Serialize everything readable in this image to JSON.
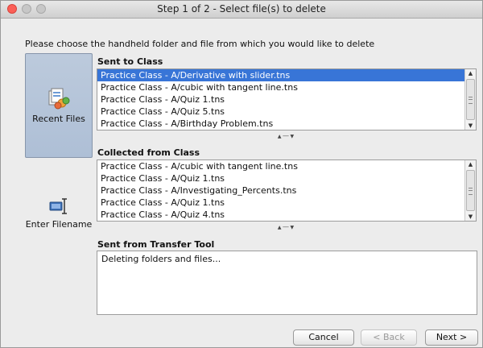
{
  "window": {
    "title": "Step 1 of 2 - Select file(s) to delete"
  },
  "instruction": "Please choose the handheld folder and file from which you would like to delete",
  "sidebar": {
    "items": [
      {
        "label": "Recent Files",
        "icon": "recent-files-icon",
        "selected": true
      },
      {
        "label": "Enter Filename",
        "icon": "enter-filename-icon",
        "selected": false
      }
    ]
  },
  "sent_to_class": {
    "label": "Sent to Class",
    "items": [
      "Practice Class - A/Derivative with slider.tns",
      "Practice Class - A/cubic with tangent line.tns",
      "Practice Class - A/Quiz 1.tns",
      "Practice Class - A/Quiz 5.tns",
      "Practice Class - A/Birthday Problem.tns"
    ],
    "selected_index": 0
  },
  "collected_from_class": {
    "label": "Collected from Class",
    "items": [
      "Practice Class - A/cubic with tangent line.tns",
      "Practice Class - A/Quiz 1.tns",
      "Practice Class - A/Investigating_Percents.tns",
      "Practice Class - A/Quiz 1.tns",
      "Practice Class - A/Quiz 4.tns"
    ]
  },
  "transfer_tool": {
    "label": "Sent from Transfer Tool",
    "log": "Deleting folders and files..."
  },
  "buttons": {
    "cancel": "Cancel",
    "back": "< Back",
    "next": "Next >"
  },
  "colors": {
    "selection": "#3875d7",
    "sidebar_selected": "#aebfd6",
    "close_button": "#fb5f57"
  }
}
